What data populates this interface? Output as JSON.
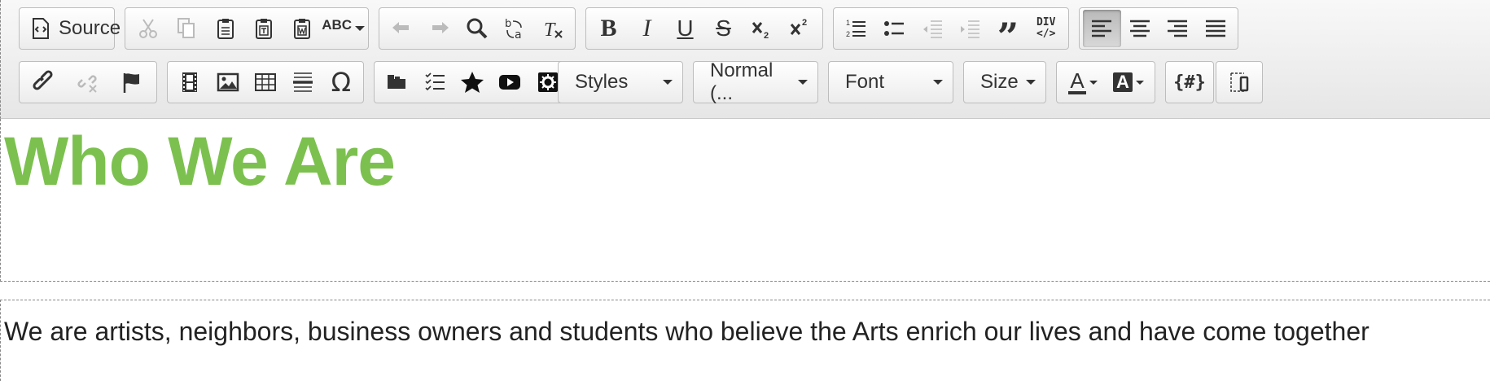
{
  "toolbar": {
    "source_label": "Source",
    "styles_label": "Styles",
    "format_label": "Normal (...",
    "font_label": "Font",
    "size_label": "Size",
    "blockquote_glyph": "”",
    "special_char_glyph": "Ω",
    "bold_glyph": "B",
    "italic_glyph": "I",
    "underline_glyph": "U",
    "strike_glyph": "S",
    "div_top": "DIV",
    "div_bottom": "</>",
    "spellcheck_label": "ABC",
    "templates_label": "{#}",
    "text_color_glyph": "A",
    "bg_color_glyph": "A"
  },
  "content": {
    "heading": "Who We Are",
    "paragraph": "We are artists, neighbors, business owners and students who believe the Arts enrich our lives and have come together"
  },
  "colors": {
    "heading_green": "#7cc14f"
  }
}
